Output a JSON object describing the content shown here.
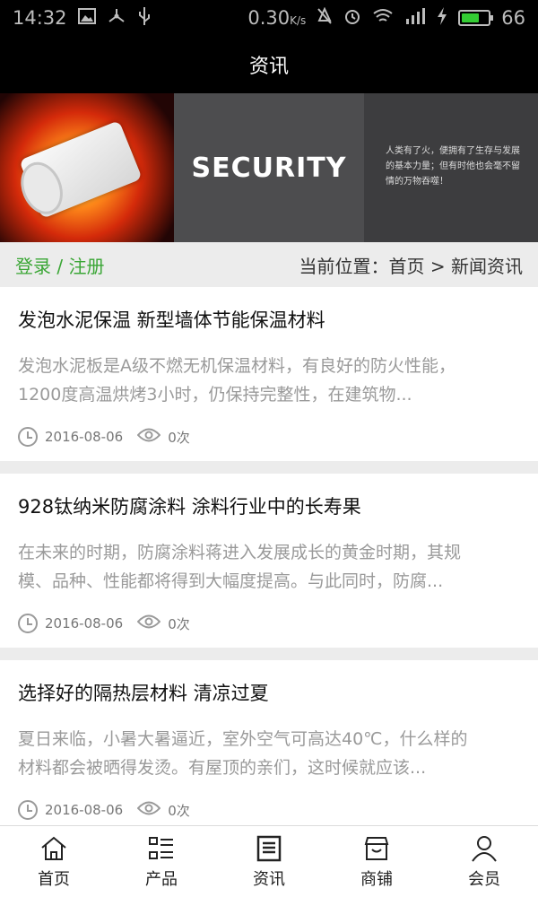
{
  "status_bar": {
    "time": "14:32",
    "net_speed": "0.30",
    "net_unit": "K/s",
    "battery_level": "66",
    "icons": [
      "image-icon",
      "usb-share-icon",
      "usb-icon",
      "mute-icon",
      "alarm-icon",
      "wifi-icon",
      "signal-icon",
      "charging-icon",
      "battery-icon"
    ]
  },
  "header": {
    "title": "资讯"
  },
  "banner": {
    "heading": "SECURITY",
    "caption": "人类有了火，便拥有了生存与发展的基本力量；但有时他也会毫不留情的万物吞噬！"
  },
  "breadcrumb": {
    "login_label": "登录 / 注册",
    "position_text": "当前位置：首页 > 新闻资讯"
  },
  "articles": [
    {
      "title": "发泡水泥保温 新型墙体节能保温材料",
      "summary_line1": "发泡水泥板是A级不燃无机保温材料，有良好的防火性能，",
      "summary_line2": "1200度高温烘烤3小时，仍保持完整性，在建筑物...",
      "date": "2016-08-06",
      "views": "0次"
    },
    {
      "title": "928钛纳米防腐涂料 涂料行业中的长寿果",
      "summary_line1": "在未来的时期，防腐涂料蒋进入发展成长的黄金时期，其规",
      "summary_line2": "模、品种、性能都将得到大幅度提高。与此同时，防腐...",
      "date": "2016-08-06",
      "views": "0次"
    },
    {
      "title": "选择好的隔热层材料 清凉过夏",
      "summary_line1": "夏日来临，小暑大暑逼近，室外空气可高达40℃，什么样的",
      "summary_line2": "材料都会被晒得发烫。有屋顶的亲们，这时候就应该...",
      "date": "2016-08-06",
      "views": "0次"
    }
  ],
  "tabbar": {
    "home": "首页",
    "products": "产品",
    "news": "资讯",
    "shops": "商铺",
    "member": "会员"
  },
  "colors": {
    "accent_green": "#3aa635",
    "header_bg": "#000000"
  }
}
